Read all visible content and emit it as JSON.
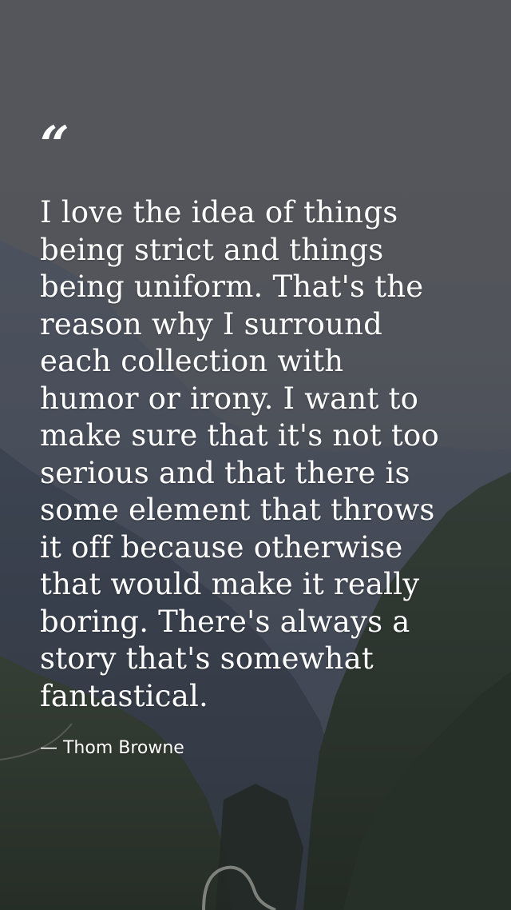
{
  "background": {
    "scene": "mountain valley at dusk",
    "colors": {
      "sky": "#5d6065",
      "ridge_far": "#4a5363",
      "ridge_mid": "#37414f",
      "forest": "#2b3a2b",
      "valley_dark": "#1e2a1f",
      "road": "#b8b8b0"
    }
  },
  "quote": {
    "mark": "“",
    "text": "I love the idea of things\nbeing strict and things\nbeing uniform. That's the\nreason why I surround\neach collection with\nhumor or irony. I want to\nmake sure that it's not too\nserious and that there is\nsome element that throws\nit off because otherwise\nthat would make it really\nboring. There's always a\nstory that's somewhat\nfantastical.",
    "author": "— Thom Browne"
  }
}
